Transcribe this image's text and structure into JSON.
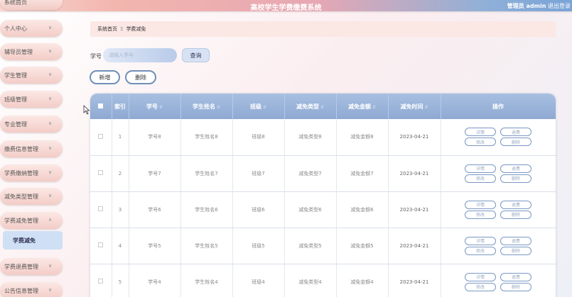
{
  "header": {
    "title": "高校学生学费缴费系统",
    "user_text": "管理员 admin",
    "logout": "退出登录"
  },
  "sidebar": {
    "items": [
      {
        "label": "系统首页"
      },
      {
        "label": "个人中心"
      },
      {
        "label": "辅导员管理"
      },
      {
        "label": "学生管理"
      },
      {
        "label": "班级管理"
      },
      {
        "label": "专业管理"
      },
      {
        "label": "缴费信息管理"
      },
      {
        "label": "学费缴纳管理"
      },
      {
        "label": "减免类型管理"
      },
      {
        "label": "学费减免管理"
      },
      {
        "label": "学费退费管理"
      },
      {
        "label": "公告信息管理"
      }
    ],
    "active_sub": "学费减免"
  },
  "breadcrumb": {
    "home": "系统首页",
    "separator": "Ξ",
    "current": "学费减免"
  },
  "search": {
    "label": "学号",
    "placeholder": "请输入学号",
    "button": "查询"
  },
  "actions": {
    "add": "新增",
    "delete": "删除"
  },
  "table": {
    "columns": [
      "索引",
      "学号",
      "学生姓名",
      "班级",
      "减免类型",
      "减免金额",
      "减免时间",
      "操作"
    ],
    "rows": [
      {
        "index": "1",
        "student_no": "学号8",
        "name": "学生姓名8",
        "class": "班级8",
        "type": "减免类型8",
        "amount": "减免金额8",
        "time": "2023-04-21"
      },
      {
        "index": "2",
        "student_no": "学号7",
        "name": "学生姓名7",
        "class": "班级7",
        "type": "减免类型7",
        "amount": "减免金额7",
        "time": "2023-04-21"
      },
      {
        "index": "3",
        "student_no": "学号6",
        "name": "学生姓名6",
        "class": "班级6",
        "type": "减免类型6",
        "amount": "减免金额6",
        "time": "2023-04-21"
      },
      {
        "index": "4",
        "student_no": "学号5",
        "name": "学生姓名5",
        "class": "班级5",
        "type": "减免类型5",
        "amount": "减免金额5",
        "time": "2023-04-21"
      },
      {
        "index": "5",
        "student_no": "学号4",
        "name": "学生姓名4",
        "class": "班级4",
        "type": "减免类型4",
        "amount": "减免金额4",
        "time": "2023-04-21"
      }
    ],
    "row_ops": [
      "详情",
      "退费",
      "修改",
      "删除"
    ]
  }
}
